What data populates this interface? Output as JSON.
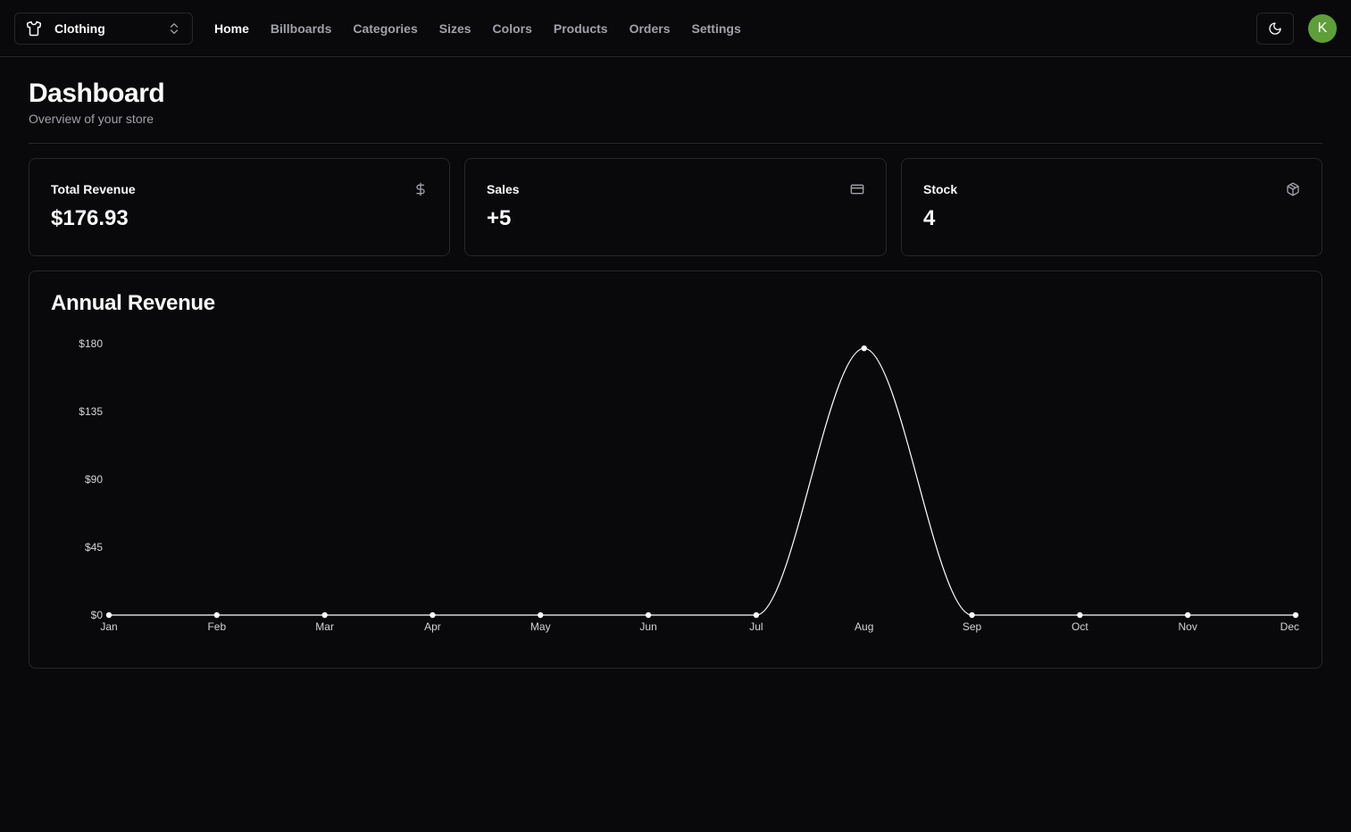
{
  "store_switcher": {
    "label": "Clothing",
    "icon": "shirt-icon"
  },
  "nav": {
    "items": [
      {
        "label": "Home",
        "active": true
      },
      {
        "label": "Billboards",
        "active": false
      },
      {
        "label": "Categories",
        "active": false
      },
      {
        "label": "Sizes",
        "active": false
      },
      {
        "label": "Colors",
        "active": false
      },
      {
        "label": "Products",
        "active": false
      },
      {
        "label": "Orders",
        "active": false
      },
      {
        "label": "Settings",
        "active": false
      }
    ]
  },
  "user": {
    "avatar_initial": "K",
    "avatar_color": "#5e9f39"
  },
  "page": {
    "title": "Dashboard",
    "subtitle": "Overview of your store"
  },
  "cards": [
    {
      "label": "Total Revenue",
      "value": "$176.93",
      "icon": "dollar-sign-icon"
    },
    {
      "label": "Sales",
      "value": "+5",
      "icon": "credit-card-icon"
    },
    {
      "label": "Stock",
      "value": "4",
      "icon": "package-icon"
    }
  ],
  "chart_section": {
    "title": "Annual Revenue"
  },
  "chart_data": {
    "type": "line",
    "title": "Annual Revenue",
    "categories": [
      "Jan",
      "Feb",
      "Mar",
      "Apr",
      "May",
      "Jun",
      "Jul",
      "Aug",
      "Sep",
      "Oct",
      "Nov",
      "Dec"
    ],
    "values": [
      0,
      0,
      0,
      0,
      0,
      0,
      0,
      176.93,
      0,
      0,
      0,
      0
    ],
    "y_ticks": [
      "$0",
      "$45",
      "$90",
      "$135",
      "$180"
    ],
    "ylim": [
      0,
      180
    ],
    "grid": false,
    "line_color": "#ffffff"
  },
  "colors": {
    "background": "#09090b",
    "border": "#27272a",
    "muted_text": "#a1a1aa",
    "text": "#fafafa"
  }
}
